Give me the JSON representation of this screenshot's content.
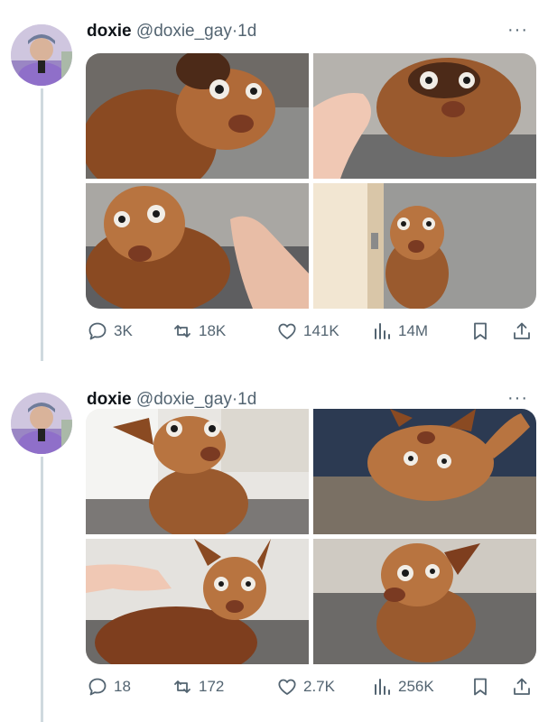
{
  "tweets": [
    {
      "display_name": "doxie",
      "handle": "@doxie_gay",
      "separator": "·",
      "time": "1d",
      "more": "···",
      "stats": {
        "replies": "3K",
        "reposts": "18K",
        "likes": "141K",
        "views": "14M"
      }
    },
    {
      "display_name": "doxie",
      "handle": "@doxie_gay",
      "separator": "·",
      "time": "1d",
      "more": "···",
      "stats": {
        "replies": "18",
        "reposts": "172",
        "likes": "2.7K",
        "views": "256K"
      }
    }
  ],
  "colors": {
    "text": "#0f1419",
    "muted": "#536471",
    "thread_line": "#cfd9de",
    "dog": "#a0562a"
  },
  "icons": [
    "reply-icon",
    "repost-icon",
    "like-icon",
    "views-icon",
    "bookmark-icon",
    "share-icon",
    "more-icon"
  ]
}
